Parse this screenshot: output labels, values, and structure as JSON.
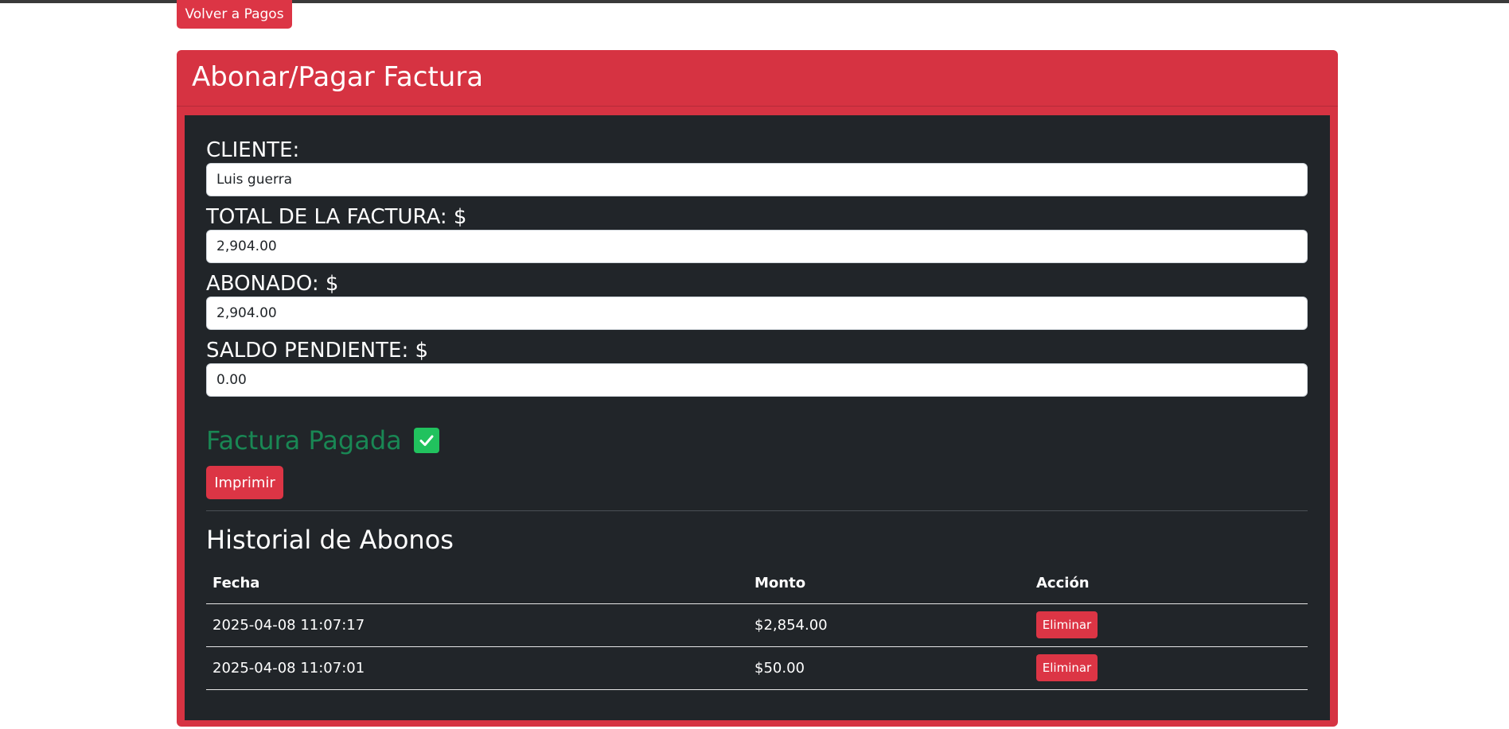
{
  "nav": {
    "back_label": "Volver a Pagos"
  },
  "card": {
    "title": "Abonar/Pagar Factura"
  },
  "form": {
    "cliente_label": "CLIENTE:",
    "cliente_value": "Luis guerra",
    "total_label": "TOTAL DE LA FACTURA: $",
    "total_value": "2,904.00",
    "abonado_label": "ABONADO: $",
    "abonado_value": "2,904.00",
    "saldo_label": "SALDO PENDIENTE: $",
    "saldo_value": "0.00"
  },
  "status": {
    "text": "Factura Pagada",
    "icon": "check-square-icon",
    "color": "#198754"
  },
  "actions": {
    "print_label": "Imprimir"
  },
  "history": {
    "title": "Historial de Abonos",
    "columns": [
      "Fecha",
      "Monto",
      "Acción"
    ],
    "rows": [
      {
        "fecha": "2025-04-08 11:07:17",
        "monto": "$2,854.00",
        "action": "Eliminar"
      },
      {
        "fecha": "2025-04-08 11:07:01",
        "monto": "$50.00",
        "action": "Eliminar"
      }
    ]
  },
  "colors": {
    "accent": "#dc3545",
    "card_bg": "#d63342",
    "body_bg": "#212529"
  }
}
